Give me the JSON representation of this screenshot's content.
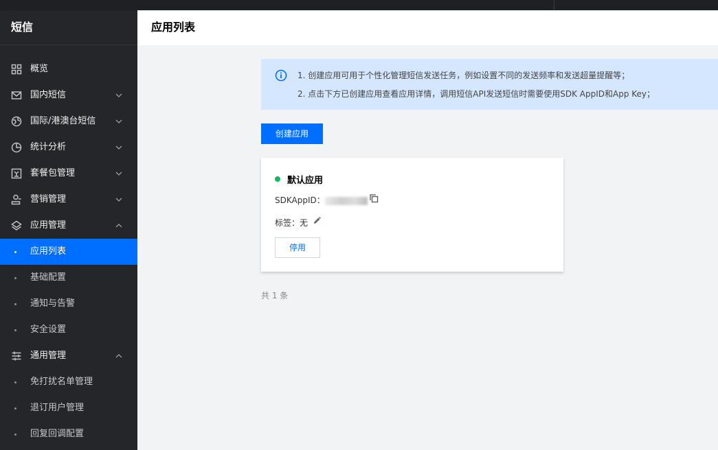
{
  "sidebar": {
    "title": "短信",
    "items": [
      {
        "label": "概览",
        "icon": "grid-icon"
      },
      {
        "label": "国内短信",
        "icon": "mail-icon"
      },
      {
        "label": "国际/港澳台短信",
        "icon": "globe-icon"
      },
      {
        "label": "统计分析",
        "icon": "pie-chart-icon"
      },
      {
        "label": "套餐包管理",
        "icon": "package-icon"
      },
      {
        "label": "营销管理",
        "icon": "user-marketing-icon"
      },
      {
        "label": "应用管理",
        "icon": "layers-icon"
      },
      {
        "label": "应用列表"
      },
      {
        "label": "基础配置"
      },
      {
        "label": "通知与告警"
      },
      {
        "label": "安全设置"
      },
      {
        "label": "通用管理",
        "icon": "sliders-icon"
      },
      {
        "label": "免打扰名单管理"
      },
      {
        "label": "退订用户管理"
      },
      {
        "label": "回复回调配置"
      }
    ]
  },
  "header": {
    "title": "应用列表"
  },
  "notice": {
    "line1": "1. 创建应用可用于个性化管理短信发送任务，例如设置不同的发送频率和发送超量提醒等；",
    "line2": "2. 点击下方已创建应用查看应用详情，调用短信API发送短信时需要使用SDK AppID和App Key；"
  },
  "create_button": "创建应用",
  "app_card": {
    "name": "默认应用",
    "sdk_label": "SDKAppID：",
    "tag_label": "标签：无",
    "stop_button": "停用",
    "status_color": "#0abf5b"
  },
  "total": "共 1 条",
  "colors": {
    "accent": "#006eff",
    "sidebar_bg": "#252629",
    "notice_bg": "#d5e7ff"
  }
}
